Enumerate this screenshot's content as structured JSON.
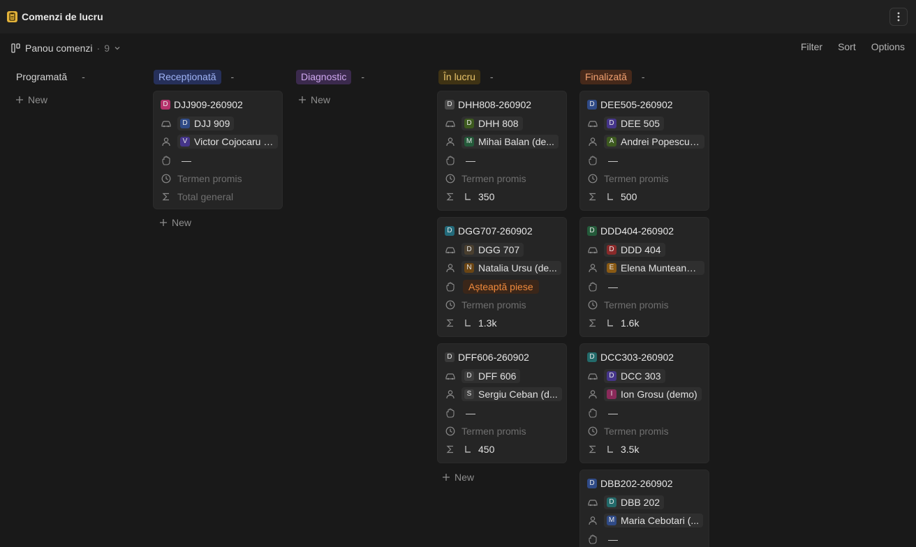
{
  "app": {
    "title": "Comenzi de lucru",
    "icon": "clipboard-icon",
    "icon_color": "#e2b23a"
  },
  "view": {
    "name": "Panou comenzi",
    "count": "9",
    "actions": {
      "filter": "Filter",
      "sort": "Sort",
      "options": "Options"
    }
  },
  "labels": {
    "new": "New",
    "deadline": "Termen promis",
    "total": "Total general",
    "empty_value": "—"
  },
  "columns": [
    {
      "name": "Programată",
      "count": "-",
      "color": "#d4d4d4",
      "bg": "transparent"
    },
    {
      "name": "Recepționată",
      "count": "-",
      "color": "#9fb3f5",
      "bg": "#26305a"
    },
    {
      "name": "Diagnostic",
      "count": "-",
      "color": "#d0a8f0",
      "bg": "#3b2a4d"
    },
    {
      "name": "În lucru",
      "count": "-",
      "color": "#e9c46a",
      "bg": "#3f3314"
    },
    {
      "name": "Finalizată",
      "count": "-",
      "color": "#f1a070",
      "bg": "#46291a"
    }
  ],
  "cards": {
    "receptionata": [
      {
        "id": "DJJ909-260902",
        "id_letter": "D",
        "id_color": "#b5326b",
        "vehicle": "DJJ 909",
        "vehicle_letter": "D",
        "vehicle_color": "#2f4a86",
        "client": "Victor Cojocaru (...",
        "client_letter": "V",
        "client_color": "#45358a",
        "status": "—",
        "deadline": "Termen promis",
        "total": "Total general"
      }
    ],
    "in_lucru": [
      {
        "id": "DHH808-260902",
        "id_letter": "D",
        "id_color": "#4a4a4a",
        "vehicle": "DHH 808",
        "vehicle_letter": "D",
        "vehicle_color": "#3d5a1f",
        "client": "Mihai Balan (de...",
        "client_letter": "M",
        "client_color": "#245a3a",
        "status": "—",
        "deadline": "Termen promis",
        "total": "350"
      },
      {
        "id": "DGG707-260902",
        "id_letter": "D",
        "id_color": "#236a7a",
        "vehicle": "DGG 707",
        "vehicle_letter": "D",
        "vehicle_color": "#4a3f2f",
        "client": "Natalia Ursu (de...",
        "client_letter": "N",
        "client_color": "#6a4514",
        "status": "Așteaptă piese",
        "deadline": "Termen promis",
        "total": "1.3k"
      },
      {
        "id": "DFF606-260902",
        "id_letter": "D",
        "id_color": "#3a3a3a",
        "vehicle": "DFF 606",
        "vehicle_letter": "D",
        "vehicle_color": "#3e3e3e",
        "client": "Sergiu Ceban (d...",
        "client_letter": "S",
        "client_color": "#3e3e3e",
        "status": "—",
        "deadline": "Termen promis",
        "total": "450"
      }
    ],
    "finalizata": [
      {
        "id": "DEE505-260902",
        "id_letter": "D",
        "id_color": "#2f4a86",
        "vehicle": "DEE 505",
        "vehicle_letter": "D",
        "vehicle_color": "#45358a",
        "client": "Andrei Popescu (...",
        "client_letter": "A",
        "client_color": "#3d5a1f",
        "status": "—",
        "deadline": "Termen promis",
        "total": "500"
      },
      {
        "id": "DDD404-260902",
        "id_letter": "D",
        "id_color": "#245a3a",
        "vehicle": "DDD 404",
        "vehicle_letter": "D",
        "vehicle_color": "#8a2a2a",
        "client": "Elena Munteanu ...",
        "client_letter": "E",
        "client_color": "#8a5a14",
        "status": "—",
        "deadline": "Termen promis",
        "total": "1.6k"
      },
      {
        "id": "DCC303-260902",
        "id_letter": "D",
        "id_color": "#236a6a",
        "vehicle": "DCC 303",
        "vehicle_letter": "D",
        "vehicle_color": "#45358a",
        "client": "Ion Grosu (demo)",
        "client_letter": "I",
        "client_color": "#8a2a5a",
        "status": "—",
        "deadline": "Termen promis",
        "total": "3.5k"
      },
      {
        "id": "DBB202-260902",
        "id_letter": "D",
        "id_color": "#2f4a86",
        "vehicle": "DBB 202",
        "vehicle_letter": "D",
        "vehicle_color": "#236a6a",
        "client": "Maria Cebotari (...",
        "client_letter": "M",
        "client_color": "#2f4a86",
        "status": "—"
      }
    ]
  }
}
